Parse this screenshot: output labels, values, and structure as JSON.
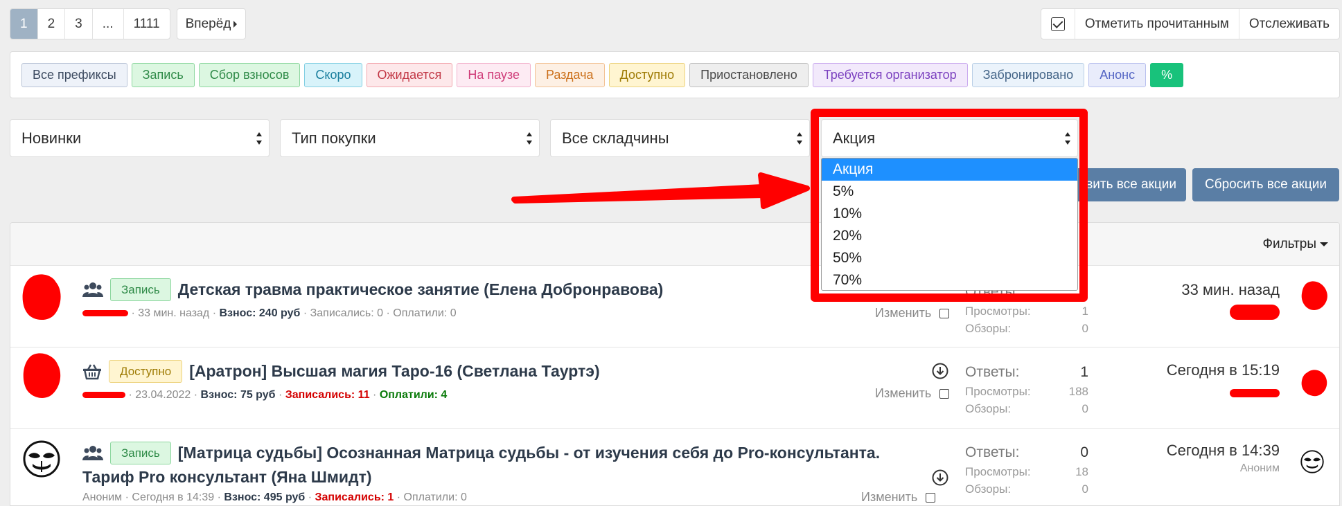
{
  "pagination": {
    "pages": [
      "1",
      "2",
      "3",
      "...",
      "1111"
    ],
    "active_page": "1",
    "next_label": "Вперёд"
  },
  "top_actions": {
    "mark_read": "Отметить прочитанным",
    "watch": "Отслеживать"
  },
  "prefixes": [
    {
      "label": "Все префиксы",
      "bg": "#eef2f9",
      "border": "#b8c3d6",
      "color": "#3c4a60"
    },
    {
      "label": "Запись",
      "bg": "#dcf7e1",
      "border": "#8dd79f",
      "color": "#2e8a47"
    },
    {
      "label": "Сбор взносов",
      "bg": "#dcf7e1",
      "border": "#8dd79f",
      "color": "#2e8a47"
    },
    {
      "label": "Скоро",
      "bg": "#d8f3fa",
      "border": "#83cfe3",
      "color": "#1b7f9e"
    },
    {
      "label": "Ожидается",
      "bg": "#fde8ea",
      "border": "#f2a5ad",
      "color": "#c23846"
    },
    {
      "label": "На паузе",
      "bg": "#fdebf3",
      "border": "#f2b1cc",
      "color": "#cf3b78"
    },
    {
      "label": "Раздача",
      "bg": "#fdf0e4",
      "border": "#f3c294",
      "color": "#cb6f19"
    },
    {
      "label": "Доступно",
      "bg": "#fff5d1",
      "border": "#ecd27c",
      "color": "#9e7b04"
    },
    {
      "label": "Приостановлено",
      "bg": "#eeeeee",
      "border": "#bfbfbf",
      "color": "#4a4a4a"
    },
    {
      "label": "Требуется организатор",
      "bg": "#f2e9fb",
      "border": "#c9a9ee",
      "color": "#7a3fbf"
    },
    {
      "label": "Забронировано",
      "bg": "#ebf3fb",
      "border": "#b9cfe6",
      "color": "#446588"
    },
    {
      "label": "Анонс",
      "bg": "#e9ecfb",
      "border": "#b8c0ee",
      "color": "#5566c4"
    },
    {
      "label": "%",
      "bg": "#18c27b",
      "border": "#18c27b",
      "color": "#ffffff"
    }
  ],
  "filters": {
    "sort": "Новинки",
    "purchase_type": "Тип покупки",
    "scope": "Все складчины",
    "promo": "Акция"
  },
  "promo_options": [
    "Акция",
    "5%",
    "10%",
    "20%",
    "50%",
    "70%"
  ],
  "buttons": {
    "show_all_partial": "вить все акции",
    "reset_all": "Сбросить все акции"
  },
  "list": {
    "filters_label": "Фильтры",
    "edit_label": "Изменить",
    "stat_labels": {
      "replies": "Ответы:",
      "views": "Просмотры:",
      "reviews": "Обзоры:"
    },
    "threads": [
      {
        "tag": "Запись",
        "tag_bg": "#dcf7e1",
        "tag_border": "#8dd79f",
        "tag_color": "#2e8a47",
        "icon": "group-icon",
        "title": "Детская травма практическое занятие (Елена Добронравова)",
        "title_line2": "",
        "author": "",
        "date": "· 33 мин. назад",
        "fee": "Взнос: 240 руб",
        "signed": "Записались: 0",
        "paid": "Оплатили: 0",
        "replies": "",
        "views": "1",
        "reviews": "0",
        "last_when": "33 мин. назад",
        "last_who": ""
      },
      {
        "tag": "Доступно",
        "tag_bg": "#fff5d1",
        "tag_border": "#ecd27c",
        "tag_color": "#9e7b04",
        "icon": "basket-icon",
        "title": "[Аратрон] Высшая магия Таро-16 (Светлана Тауртэ)",
        "title_line2": "",
        "author": "",
        "date": "· 23.04.2022",
        "fee": "Взнос: 75 руб",
        "signed": "Записались: 11",
        "paid": "Оплатили: 4",
        "replies": "1",
        "views": "188",
        "reviews": "0",
        "last_when": "Сегодня в 15:19",
        "last_who": ""
      },
      {
        "tag": "Запись",
        "tag_bg": "#dcf7e1",
        "tag_border": "#8dd79f",
        "tag_color": "#2e8a47",
        "icon": "group-icon",
        "title": "[Матрица судьбы] Осознанная Матрица судьбы - от изучения себя до Pro-консультанта.",
        "title_line2": "Тариф Pro консультант (Яна Шмидт)",
        "author": "Аноним",
        "date": "· Сегодня в 14:39",
        "fee": "Взнос: 495 руб",
        "signed": "Записались: 1",
        "paid": "Оплатили: 0",
        "replies": "0",
        "views": "18",
        "reviews": "0",
        "last_when": "Сегодня в 14:39",
        "last_who": "Аноним"
      }
    ]
  }
}
